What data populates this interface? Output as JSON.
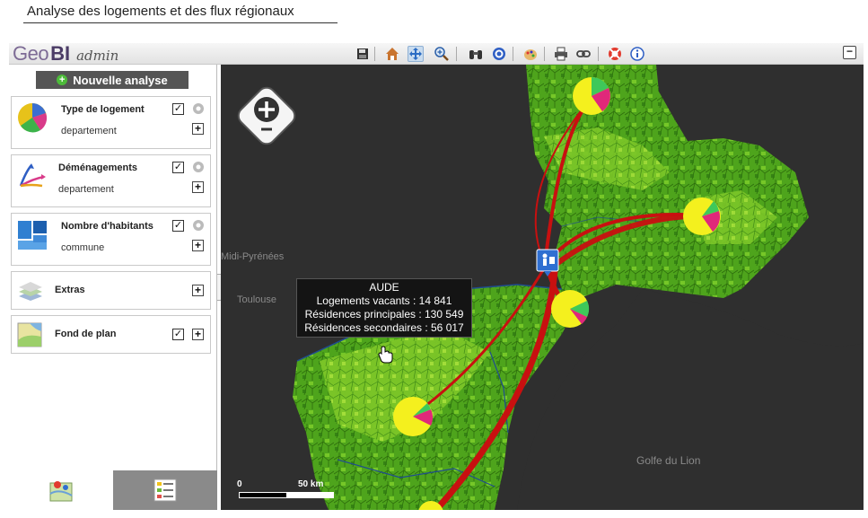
{
  "page": {
    "title": "Analyse des logements et des flux régionaux"
  },
  "brand": {
    "geo": "Geo",
    "bi": "BI",
    "admin": "admin"
  },
  "toolbar": {
    "icons": [
      "save-icon",
      "home-icon",
      "pan-icon",
      "zoom-in-icon",
      "binoculars-icon",
      "target-icon",
      "style-icon",
      "print-icon",
      "link-icon",
      "help-icon",
      "info-icon"
    ],
    "active": "pan-icon"
  },
  "sidebar": {
    "new_analysis": "Nouvelle analyse",
    "panels": [
      {
        "title": "Type de logement",
        "subtitle": "departement",
        "checked": true,
        "icon": "pie-chart-icon"
      },
      {
        "title": "Déménagements",
        "subtitle": "departement",
        "checked": true,
        "icon": "flow-arrows-icon"
      },
      {
        "title": "Nombre d'habitants",
        "subtitle": "commune",
        "checked": true,
        "icon": "choropleth-icon"
      },
      {
        "title": "Extras",
        "subtitle": "",
        "checked": false,
        "icon": "layers-icon"
      },
      {
        "title": "Fond de plan",
        "subtitle": "",
        "checked": true,
        "icon": "basemap-icon"
      }
    ],
    "check_mark": "✓",
    "plus_mark": "+"
  },
  "map": {
    "labels": {
      "midi_pyrenees": "Midi-Pyrénées",
      "toulouse": "Toulouse",
      "golfe": "Golfe du Lion"
    },
    "tooltip": {
      "title": "AUDE",
      "line1": "Logements vacants : 14 841",
      "line2": "Résidences principales : 130 549",
      "line3": "Résidences secondaires : 56 017"
    },
    "scale": {
      "start": "0",
      "end": "50 km"
    },
    "colors": {
      "land_dark": "#2f7a12",
      "land_light": "#8fd42c",
      "flow": "#c81010",
      "pie_yellow": "#f4f01e",
      "pie_pink": "#e0287a",
      "pie_green": "#3fc85a"
    }
  }
}
